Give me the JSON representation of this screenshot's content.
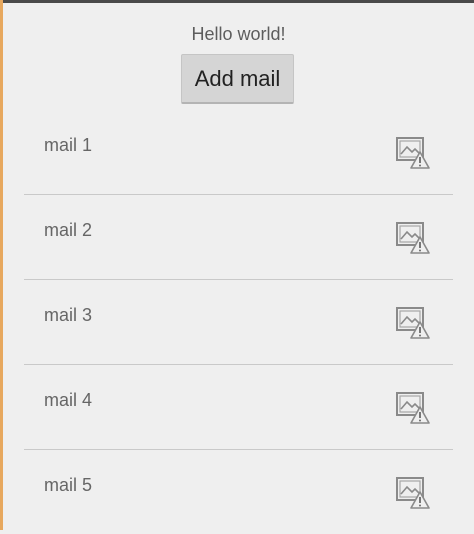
{
  "header": {
    "greeting": "Hello world!",
    "add_button_label": "Add mail"
  },
  "mails": [
    {
      "label": "mail 1",
      "icon": "broken-image-icon"
    },
    {
      "label": "mail 2",
      "icon": "broken-image-icon"
    },
    {
      "label": "mail 3",
      "icon": "broken-image-icon"
    },
    {
      "label": "mail 4",
      "icon": "broken-image-icon"
    },
    {
      "label": "mail 5",
      "icon": "broken-image-icon"
    }
  ],
  "colors": {
    "background": "#efefef",
    "button": "#d5d5d5",
    "left_edge": "#e7a85e",
    "divider": "#c9c9c9"
  }
}
